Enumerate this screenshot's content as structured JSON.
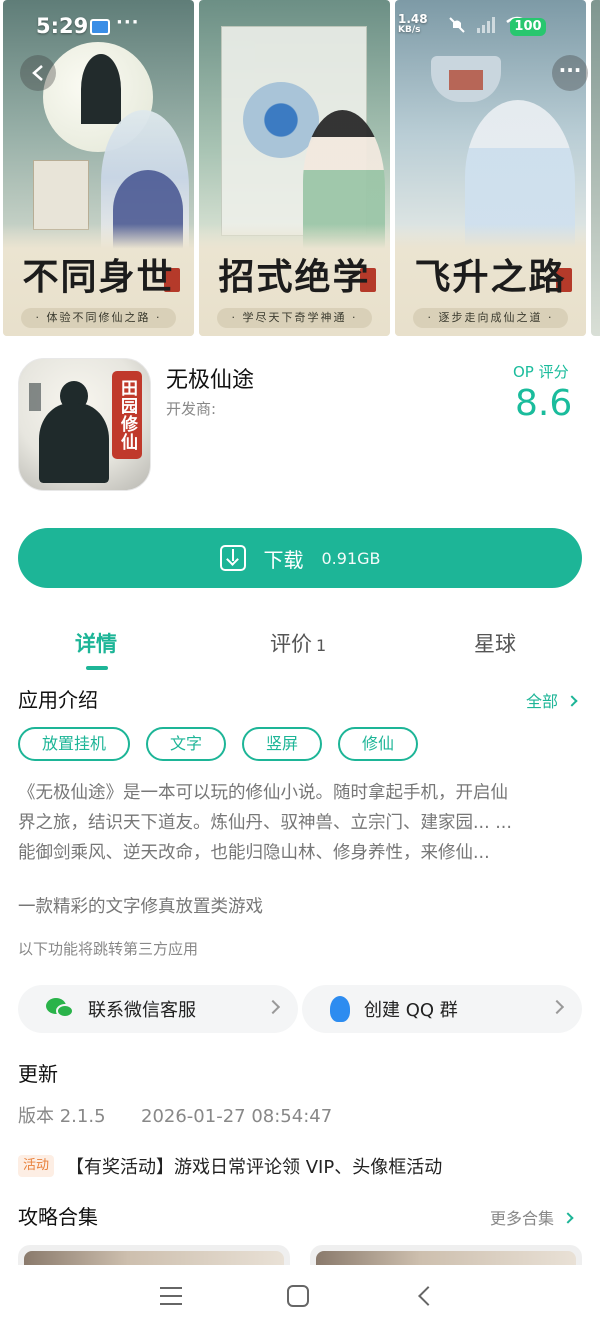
{
  "status_bar": {
    "time": "5:29",
    "speed_value": "1.48",
    "speed_unit": "KB/s",
    "battery": "100"
  },
  "screenshots": [
    {
      "title": "不同身世",
      "subtitle": "· 体验不同修仙之路 ·",
      "colors": [
        "#dfe7e2",
        "#9fb8b2"
      ]
    },
    {
      "title": "招式绝学",
      "subtitle": "· 学尽天下奇学神通 ·",
      "colors": [
        "#e3ebe4",
        "#b5cdbd"
      ]
    },
    {
      "title": "飞升之路",
      "subtitle": "· 逐步走向成仙之道 ·",
      "colors": [
        "#e6eef0",
        "#bccfd8"
      ]
    }
  ],
  "app": {
    "name": "无极仙途",
    "developer_label": "开发商:",
    "icon_tag": "田园修仙",
    "rating_label": "OP 评分",
    "rating": "8.6"
  },
  "download": {
    "label": "下载",
    "size": "0.91GB"
  },
  "tabs": [
    {
      "label": "详情",
      "active": true
    },
    {
      "label": "评价",
      "count": "1"
    },
    {
      "label": "星球"
    }
  ],
  "intro": {
    "title": "应用介绍",
    "see_all": "全部",
    "tags": [
      "放置挂机",
      "文字",
      "竖屏",
      "修仙"
    ],
    "description_lines": [
      "《无极仙途》是一本可以玩的修仙小说。随时拿起手机，开启仙",
      "界之旅，结识天下道友。炼仙丹、驭神兽、立宗门、建家园... ...",
      "能御剑乘风、逆天改命，也能归隐山林、修身养性，来修仙..."
    ],
    "tagline": "一款精彩的文字修真放置类游戏",
    "third_party_note": "以下功能将跳转第三方应用",
    "contact_wechat": "联系微信客服",
    "contact_qq": "创建 QQ 群"
  },
  "update": {
    "title": "更新",
    "version_label": "版本 2.1.5",
    "date": "2026-01-27 08:54:47",
    "activity_badge": "活动",
    "activity_text": "【有奖活动】游戏日常评论领 VIP、头像框活动"
  },
  "guides": {
    "title": "攻略合集",
    "more": "更多合集"
  },
  "theme": {
    "accent": "#1db597"
  }
}
